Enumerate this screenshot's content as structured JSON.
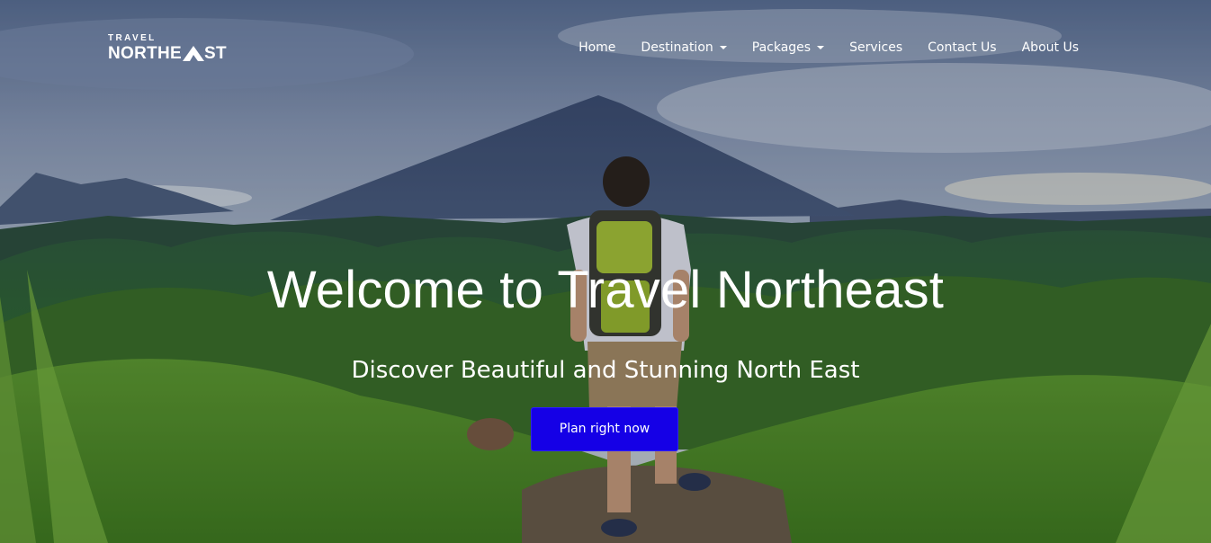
{
  "brand": {
    "top_text": "TRAVEL",
    "main_text": "NORTHE",
    "main_text_end": "ST",
    "logo_icon": "mountain-peak-icon"
  },
  "nav": {
    "items": [
      {
        "label": "Home",
        "dropdown": false
      },
      {
        "label": "Destination",
        "dropdown": true
      },
      {
        "label": "Packages",
        "dropdown": true
      },
      {
        "label": "Services",
        "dropdown": false
      },
      {
        "label": "Contact Us",
        "dropdown": false
      },
      {
        "label": "About Us",
        "dropdown": false
      }
    ]
  },
  "hero": {
    "title": "Welcome to Travel Northeast",
    "subtitle": "Discover Beautiful and Stunning North East",
    "cta_label": "Plan right now",
    "cta_color": "#1500e6"
  }
}
